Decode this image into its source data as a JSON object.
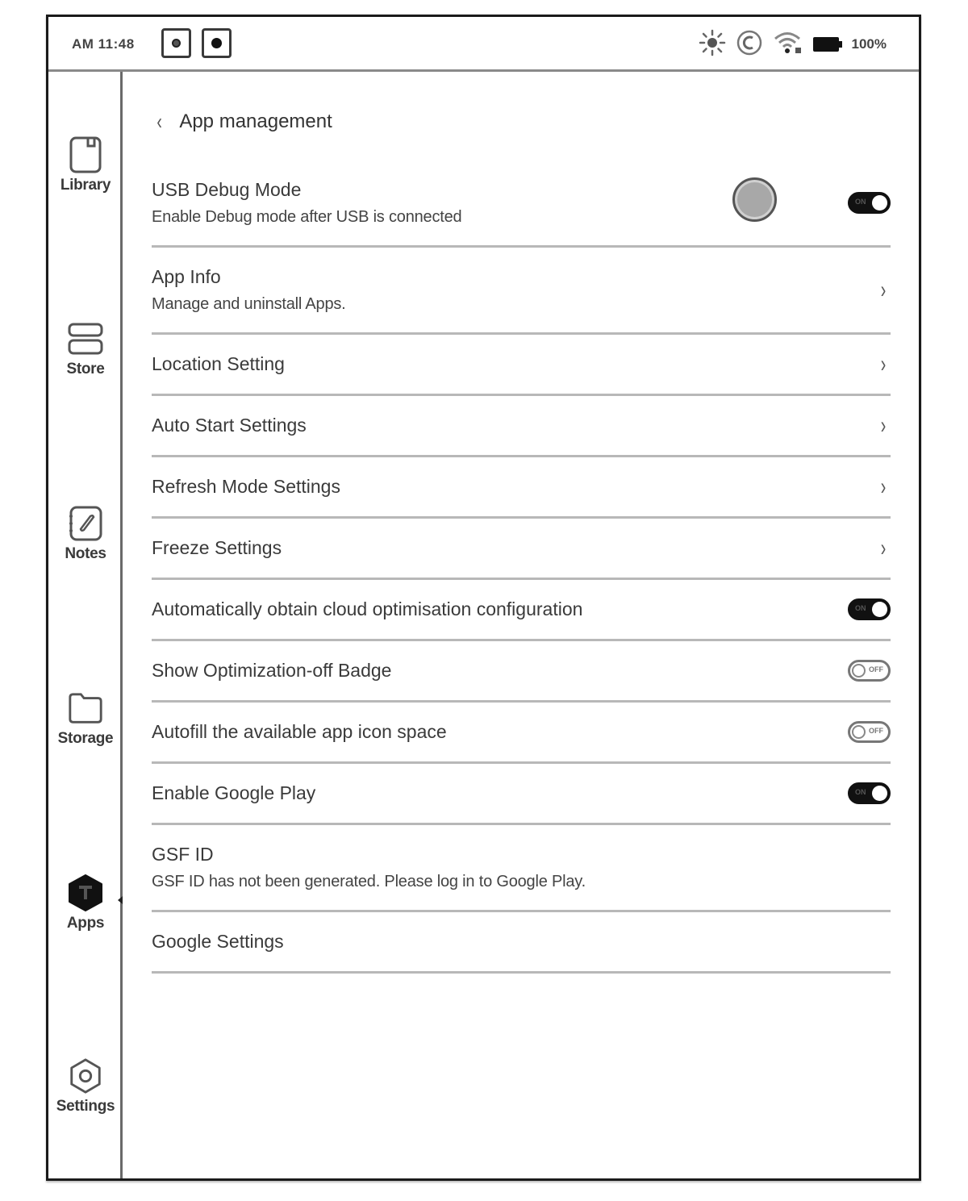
{
  "status_bar": {
    "time": "AM 11:48",
    "left_icons": [
      "refresh-indicator-icon",
      "record-indicator-icon"
    ],
    "right_icons": [
      "brightness-icon",
      "sync-icon",
      "wifi-icon",
      "battery-icon"
    ],
    "battery_percent": "100%"
  },
  "sidebar": {
    "items": [
      {
        "label": "Library",
        "icon": "library-icon",
        "active": false
      },
      {
        "label": "Store",
        "icon": "store-icon",
        "active": false
      },
      {
        "label": "Notes",
        "icon": "notes-icon",
        "active": false
      },
      {
        "label": "Storage",
        "icon": "folder-icon",
        "active": false
      },
      {
        "label": "Apps",
        "icon": "apps-icon",
        "active": true
      },
      {
        "label": "Settings",
        "icon": "settings-icon",
        "active": false
      }
    ]
  },
  "header": {
    "back_icon": "chevron-left-icon",
    "title": "App management"
  },
  "settings": [
    {
      "title": "USB Debug Mode",
      "subtitle": "Enable Debug mode after USB is connected",
      "control": "toggle",
      "state": "on",
      "state_label": "ON"
    },
    {
      "title": "App Info",
      "subtitle": "Manage and uninstall Apps.",
      "control": "chevron"
    },
    {
      "title": "Location Setting",
      "control": "chevron"
    },
    {
      "title": "Auto Start Settings",
      "control": "chevron"
    },
    {
      "title": "Refresh Mode Settings",
      "control": "chevron"
    },
    {
      "title": "Freeze Settings",
      "control": "chevron"
    },
    {
      "title": "Automatically obtain cloud optimisation configuration",
      "control": "toggle",
      "state": "on",
      "state_label": "ON"
    },
    {
      "title": "Show Optimization-off Badge",
      "control": "toggle",
      "state": "off",
      "state_label": "OFF"
    },
    {
      "title": "Autofill the available app icon space",
      "control": "toggle",
      "state": "off",
      "state_label": "OFF"
    },
    {
      "title": "Enable Google Play",
      "control": "toggle",
      "state": "on",
      "state_label": "ON"
    },
    {
      "title": "GSF ID",
      "subtitle": "GSF ID has not been generated. Please log in to Google Play.",
      "control": "none"
    },
    {
      "title": "Google Settings",
      "control": "none"
    }
  ],
  "floating_ball": {
    "icon": "floating-ball-icon"
  },
  "chevron_glyph": "›",
  "back_glyph": "‹"
}
